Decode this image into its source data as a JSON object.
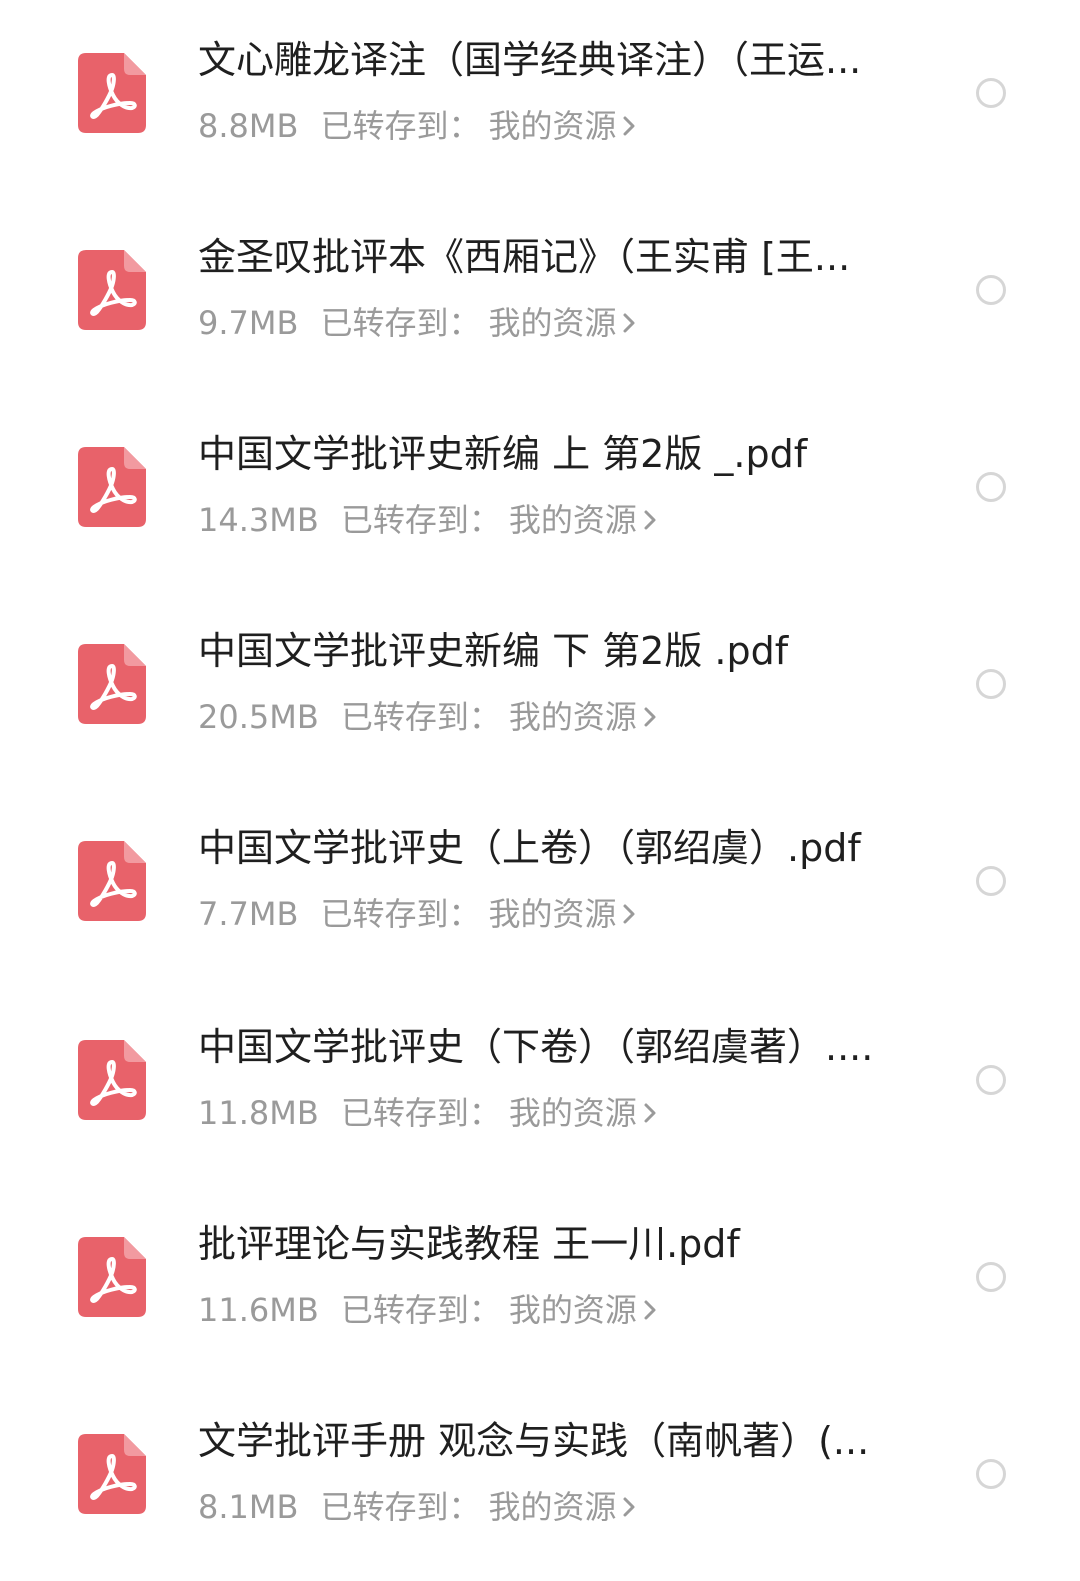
{
  "colors": {
    "pdf_icon": "#e8626a",
    "title_text": "#1f1f1f",
    "meta_text": "#9a9a9a",
    "radio_border": "#d6d6d6"
  },
  "files": [
    {
      "name": "文心雕龙译注（国学经典译注）（王运...",
      "size": "8.8MB",
      "saved_to_label": "已转存到：",
      "saved_location": "我的资源",
      "icon": "pdf-file-icon"
    },
    {
      "name": "金圣叹批评本《西厢记》（王实甫 [王...",
      "size": "9.7MB",
      "saved_to_label": "已转存到：",
      "saved_location": "我的资源",
      "icon": "pdf-file-icon"
    },
    {
      "name": "中国文学批评史新编 上 第2版 _.pdf",
      "size": "14.3MB",
      "saved_to_label": "已转存到：",
      "saved_location": "我的资源",
      "icon": "pdf-file-icon"
    },
    {
      "name": "中国文学批评史新编 下 第2版 .pdf",
      "size": "20.5MB",
      "saved_to_label": "已转存到：",
      "saved_location": "我的资源",
      "icon": "pdf-file-icon"
    },
    {
      "name": "中国文学批评史（上卷）（郭绍虞）.pdf",
      "size": "7.7MB",
      "saved_to_label": "已转存到：",
      "saved_location": "我的资源",
      "icon": "pdf-file-icon"
    },
    {
      "name": "中国文学批评史（下卷）（郭绍虞著）....",
      "size": "11.8MB",
      "saved_to_label": "已转存到：",
      "saved_location": "我的资源",
      "icon": "pdf-file-icon"
    },
    {
      "name": "批评理论与实践教程 王一川.pdf",
      "size": "11.6MB",
      "saved_to_label": "已转存到：",
      "saved_location": "我的资源",
      "icon": "pdf-file-icon"
    },
    {
      "name": "文学批评手册 观念与实践（南帆著）(...",
      "size": "8.1MB",
      "saved_to_label": "已转存到：",
      "saved_location": "我的资源",
      "icon": "pdf-file-icon"
    }
  ]
}
